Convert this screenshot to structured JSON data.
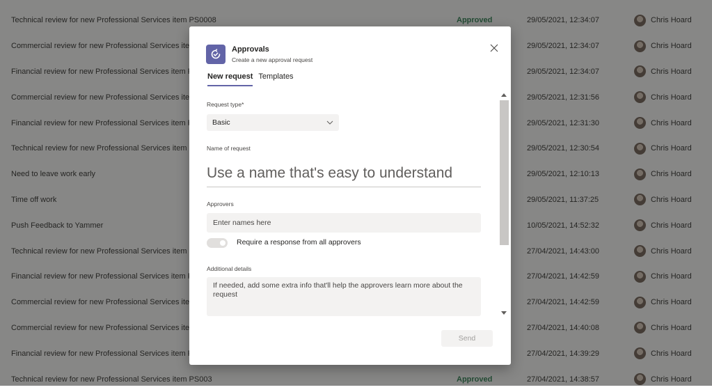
{
  "background_rows": [
    {
      "title": "Technical review for new Professional Services item PS0008",
      "status": "Approved",
      "date": "29/05/2021, 12:34:07",
      "user": "Chris Hoard"
    },
    {
      "title": "Commercial review for new Professional Services item",
      "status": "",
      "date": "29/05/2021, 12:34:07",
      "user": "Chris Hoard"
    },
    {
      "title": "Financial review for new Professional Services item PS",
      "status": "",
      "date": "29/05/2021, 12:34:07",
      "user": "Chris Hoard"
    },
    {
      "title": "Commercial review for new Professional Services item",
      "status": "",
      "date": "29/05/2021, 12:31:56",
      "user": "Chris Hoard"
    },
    {
      "title": "Financial review for new Professional Services item PS",
      "status": "",
      "date": "29/05/2021, 12:31:30",
      "user": "Chris Hoard"
    },
    {
      "title": "Technical review for new Professional Services item PS",
      "status": "",
      "date": "29/05/2021, 12:30:54",
      "user": "Chris Hoard"
    },
    {
      "title": "Need to leave work early",
      "status": "",
      "date": "29/05/2021, 12:10:13",
      "user": "Chris Hoard"
    },
    {
      "title": "Time off work",
      "status": "",
      "date": "29/05/2021, 11:37:25",
      "user": "Chris Hoard"
    },
    {
      "title": "Push Feedback to Yammer",
      "status": "",
      "date": "10/05/2021, 14:52:32",
      "user": "Chris Hoard"
    },
    {
      "title": "Technical review for new Professional Services item PS",
      "status": "",
      "date": "27/04/2021, 14:43:00",
      "user": "Chris Hoard"
    },
    {
      "title": "Financial review for new Professional Services item PS",
      "status": "",
      "date": "27/04/2021, 14:42:59",
      "user": "Chris Hoard"
    },
    {
      "title": "Commercial review for new Professional Services item",
      "status": "",
      "date": "27/04/2021, 14:42:59",
      "user": "Chris Hoard"
    },
    {
      "title": "Commercial review for new Professional Services item",
      "status": "",
      "date": "27/04/2021, 14:40:08",
      "user": "Chris Hoard"
    },
    {
      "title": "Financial review for new Professional Services item PS",
      "status": "",
      "date": "27/04/2021, 14:39:29",
      "user": "Chris Hoard"
    },
    {
      "title": "Technical review for new Professional Services item PS003",
      "status": "Approved",
      "date": "27/04/2021, 14:38:57",
      "user": "Chris Hoard"
    }
  ],
  "dialog": {
    "app_name": "Approvals",
    "subtitle": "Create a new approval request",
    "tabs": [
      {
        "label": "New request",
        "active": true
      },
      {
        "label": "Templates",
        "active": false
      }
    ],
    "request_type_label": "Request type*",
    "request_type_value": "Basic",
    "name_label": "Name of request",
    "name_placeholder": "Use a name that's easy to understand",
    "approvers_label": "Approvers",
    "approvers_placeholder": "Enter names here",
    "toggle_label": "Require a response from all approvers",
    "details_label": "Additional details",
    "details_placeholder": "If needed, add some extra info that'll help the approvers learn more about the request",
    "send_label": "Send"
  },
  "colors": {
    "brand": "#6264a7",
    "approved": "#237b4b",
    "field_bg": "#f3f2f1"
  }
}
